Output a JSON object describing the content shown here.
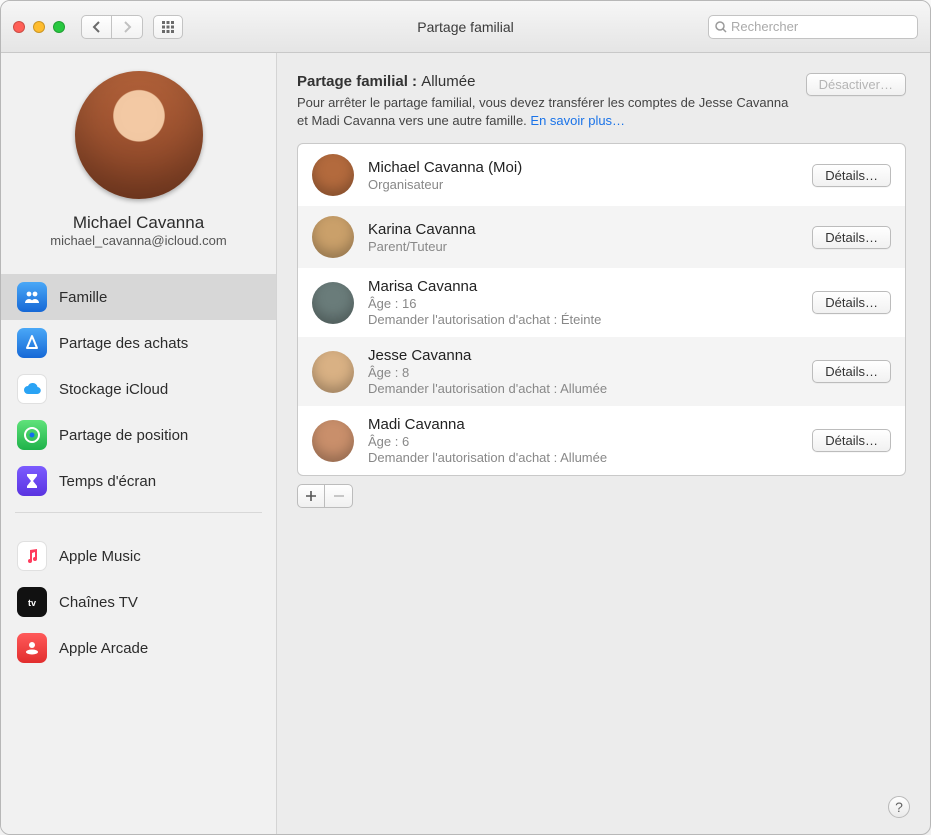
{
  "window": {
    "title": "Partage familial",
    "search_placeholder": "Rechercher"
  },
  "profile": {
    "name": "Michael Cavanna",
    "email": "michael_cavanna@icloud.com"
  },
  "sidebar": {
    "items": [
      {
        "label": "Famille",
        "icon": "family",
        "selected": true
      },
      {
        "label": "Partage des achats",
        "icon": "purchase",
        "selected": false
      },
      {
        "label": "Stockage iCloud",
        "icon": "cloud",
        "selected": false
      },
      {
        "label": "Partage de position",
        "icon": "location",
        "selected": false
      },
      {
        "label": "Temps d'écran",
        "icon": "screentime",
        "selected": false
      }
    ],
    "items2": [
      {
        "label": "Apple Music",
        "icon": "music"
      },
      {
        "label": "Chaînes TV",
        "icon": "tv"
      },
      {
        "label": "Apple Arcade",
        "icon": "arcade"
      }
    ]
  },
  "main": {
    "title_prefix": "Partage familial : ",
    "status": "Allumée",
    "deactivate_label": "Désactiver…",
    "description": "Pour arrêter le partage familial, vous devez transférer les comptes de Jesse Cavanna et Madi Cavanna vers une autre famille. ",
    "learn_more": "En savoir plus…",
    "details_label": "Détails…",
    "members": [
      {
        "name": "Michael Cavanna (Moi)",
        "role": "Organisateur",
        "ask": "",
        "avatar": "#b36a3d"
      },
      {
        "name": "Karina Cavanna",
        "role": "Parent/Tuteur",
        "ask": "",
        "avatar": "#caa06a"
      },
      {
        "name": "Marisa Cavanna",
        "role": "Âge : 16",
        "ask": "Demander l'autorisation d'achat : Éteinte",
        "avatar": "#6a7c7a"
      },
      {
        "name": "Jesse Cavanna",
        "role": "Âge : 8",
        "ask": "Demander l'autorisation d'achat : Allumée",
        "avatar": "#d9b184"
      },
      {
        "name": "Madi Cavanna",
        "role": "Âge : 6",
        "ask": "Demander l'autorisation d'achat : Allumée",
        "avatar": "#c98f6b"
      }
    ]
  }
}
